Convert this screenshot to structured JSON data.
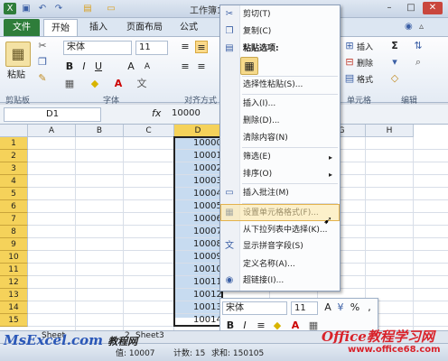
{
  "window": {
    "title": "工作簿1 - M"
  },
  "ribbon": {
    "tabs": [
      "文件",
      "开始",
      "插入",
      "页面布局",
      "公式"
    ],
    "font_name": "宋体",
    "font_size": "11",
    "groups": {
      "clipboard": "剪贴板",
      "font": "字体",
      "alignment": "对齐方式",
      "cells": "单元格",
      "editing": "编辑"
    },
    "paste_label": "粘贴",
    "cells_insert": "插入",
    "cells_delete": "删除",
    "cells_format": "格式",
    "icons": [
      "cut-icon",
      "copy-icon",
      "format-painter-icon",
      "bold-icon",
      "italic-icon",
      "underline-icon",
      "sum-icon",
      "sort-icon",
      "find-icon"
    ]
  },
  "formula_bar": {
    "name_box": "D1",
    "fx": "fx",
    "value": "10000"
  },
  "grid": {
    "columns": [
      "A",
      "B",
      "C",
      "D",
      "E",
      "F",
      "G",
      "H"
    ],
    "rows": [
      "1",
      "2",
      "3",
      "4",
      "5",
      "6",
      "7",
      "8",
      "9",
      "10",
      "11",
      "12",
      "13",
      "14",
      "15"
    ],
    "d_values": [
      "10000",
      "10001",
      "10002",
      "10003",
      "10004",
      "10005",
      "10006",
      "10007",
      "10008",
      "10009",
      "10010",
      "10011",
      "10012",
      "10013",
      "10014"
    ]
  },
  "context_menu": {
    "items": [
      {
        "label": "剪切(T)",
        "icon": "scissors-icon"
      },
      {
        "label": "复制(C)",
        "icon": "copy-icon"
      },
      {
        "label": "粘贴选项:",
        "icon": "paste-icon"
      },
      {
        "label": "选择性粘贴(S)...",
        "icon": ""
      },
      {
        "label": "插入(I)...",
        "icon": ""
      },
      {
        "label": "删除(D)...",
        "icon": ""
      },
      {
        "label": "清除内容(N)",
        "icon": ""
      },
      {
        "label": "筛选(E)",
        "icon": ""
      },
      {
        "label": "排序(O)",
        "icon": ""
      },
      {
        "label": "插入批注(M)",
        "icon": "comment-icon"
      },
      {
        "label": "设置单元格格式(F)...",
        "icon": "format-cells-icon"
      },
      {
        "label": "从下拉列表中选择(K)...",
        "icon": ""
      },
      {
        "label": "显示拼音字段(S)",
        "icon": "pinyin-icon"
      },
      {
        "label": "定义名称(A)...",
        "icon": ""
      },
      {
        "label": "超链接(I)...",
        "icon": "hyperlink-icon"
      }
    ]
  },
  "mini_toolbar": {
    "font_name": "宋体",
    "font_size": "11",
    "percent": "%"
  },
  "sheet_tabs": {
    "tab1": "Sheet",
    "tab2": "2",
    "tab3": "Sheet3"
  },
  "status_bar": {
    "avg": "值: 10007",
    "count": "计数: 15",
    "sum": "求和: 150105"
  },
  "watermark": {
    "left": "MsExcel.com",
    "left_cn": "教程网",
    "right": "Office教程学习网",
    "url": "www.office68.com"
  }
}
